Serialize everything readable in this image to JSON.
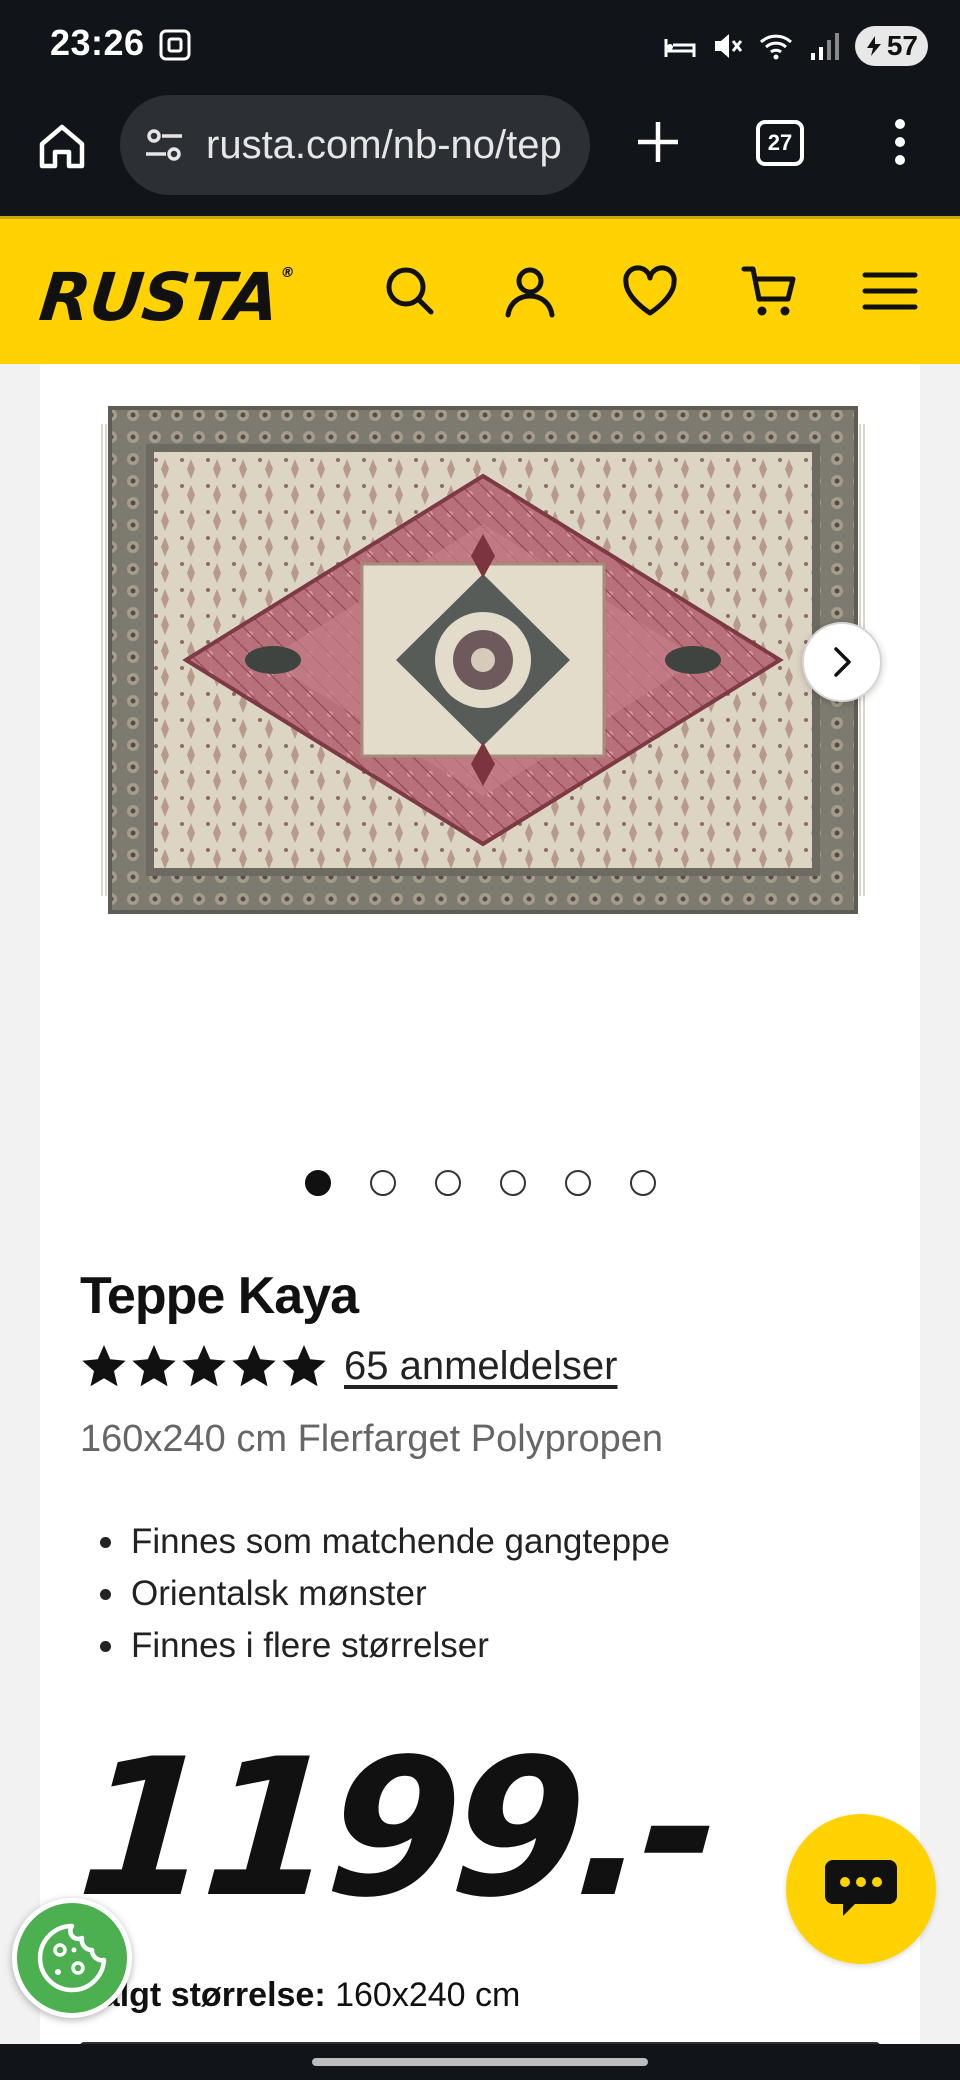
{
  "status_bar": {
    "time": "23:26",
    "battery": "57",
    "icons": [
      "screenshot-icon",
      "sleep-icon",
      "mute-icon",
      "wifi-icon",
      "signal-icon",
      "battery-icon"
    ]
  },
  "browser": {
    "url": "rusta.com/nb-no/tep",
    "tab_count": "27",
    "icons": [
      "home-icon",
      "site-settings-icon",
      "new-tab-icon",
      "tabs-icon",
      "more-menu-icon"
    ]
  },
  "header": {
    "logo": "RUSTA",
    "logo_mark": "®",
    "brand_color": "#ffd200",
    "icons": [
      "search-icon",
      "account-icon",
      "wishlist-heart-icon",
      "cart-icon",
      "menu-icon"
    ]
  },
  "gallery": {
    "image_count": 6,
    "active_index": 0,
    "next_icon": "chevron-right-icon"
  },
  "product": {
    "title": "Teppe Kaya",
    "rating_stars": 5,
    "reviews": "65 anmeldelser",
    "subtitle": "160x240 cm Flerfarget Polypropen",
    "features": [
      "Finnes som matchende gangteppe",
      "Orientalsk mønster",
      "Finnes i flere størrelser"
    ],
    "price": "1199.-",
    "size_label": "Valgt størrelse:",
    "size_value": "160x240 cm"
  },
  "floating": {
    "chat_icon": "chat-bubble-icon",
    "cookie_icon": "cookie-icon"
  }
}
